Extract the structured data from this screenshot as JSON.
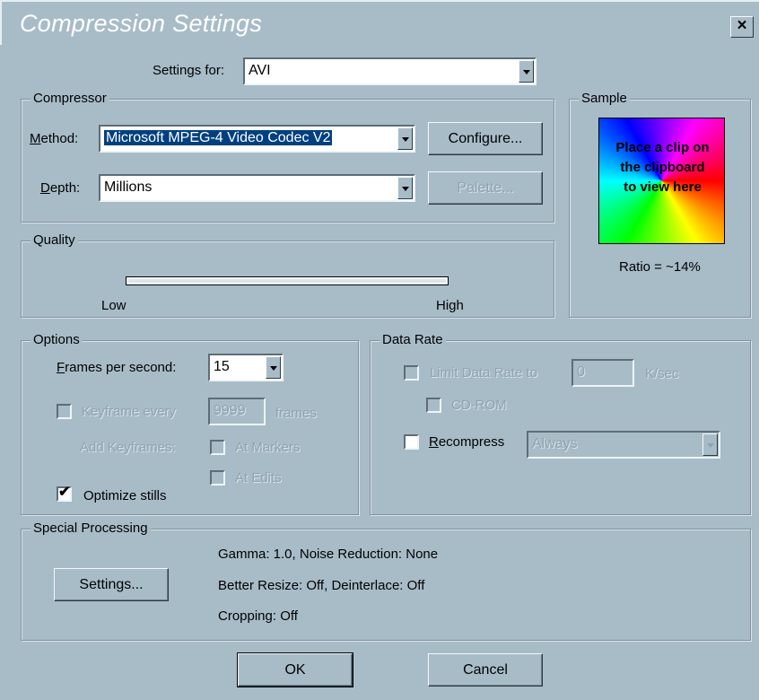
{
  "window": {
    "title": "Compression Settings",
    "close_glyph": "×"
  },
  "settings_for": {
    "label": "Settings for:",
    "value": "AVI"
  },
  "compressor": {
    "legend": "Compressor",
    "method_label": "Method:",
    "method_value": "Microsoft MPEG-4 Video Codec V2",
    "configure_label": "Configure...",
    "depth_label": "Depth:",
    "depth_value": "Millions",
    "palette_label": "Palette..."
  },
  "sample": {
    "legend": "Sample",
    "text": "Place a clip on the clipboard to view here",
    "ratio": "Ratio = ~14%"
  },
  "quality": {
    "legend": "Quality",
    "low": "Low",
    "high": "High",
    "level_fraction": 1.0
  },
  "options": {
    "legend": "Options",
    "fps_label": "Frames per second:",
    "fps_value": "15",
    "keyframe_label": "Keyframe every",
    "keyframe_value": "9999",
    "frames_label": "frames",
    "add_keyframes_label": "Add Keyframes:",
    "at_markers_label": "At Markers",
    "at_edits_label": "At Edits",
    "optimize_label": "Optimize stills",
    "optimize_checked": true
  },
  "data_rate": {
    "legend": "Data Rate",
    "limit_label": "Limit Data Rate to",
    "limit_value": "0",
    "unit": "K/sec",
    "cdrom_label": "CD-ROM",
    "recompress_label": "Recompress",
    "recompress_value": "Always"
  },
  "special": {
    "legend": "Special Processing",
    "settings_label": "Settings...",
    "line1": "Gamma: 1.0, Noise Reduction: None",
    "line2": "Better Resize: Off, Deinterlace: Off",
    "line3": "Cropping: Off"
  },
  "footer": {
    "ok": "OK",
    "cancel": "Cancel"
  },
  "colors": {
    "face": "#a8bcc8",
    "selection": "#004080"
  }
}
